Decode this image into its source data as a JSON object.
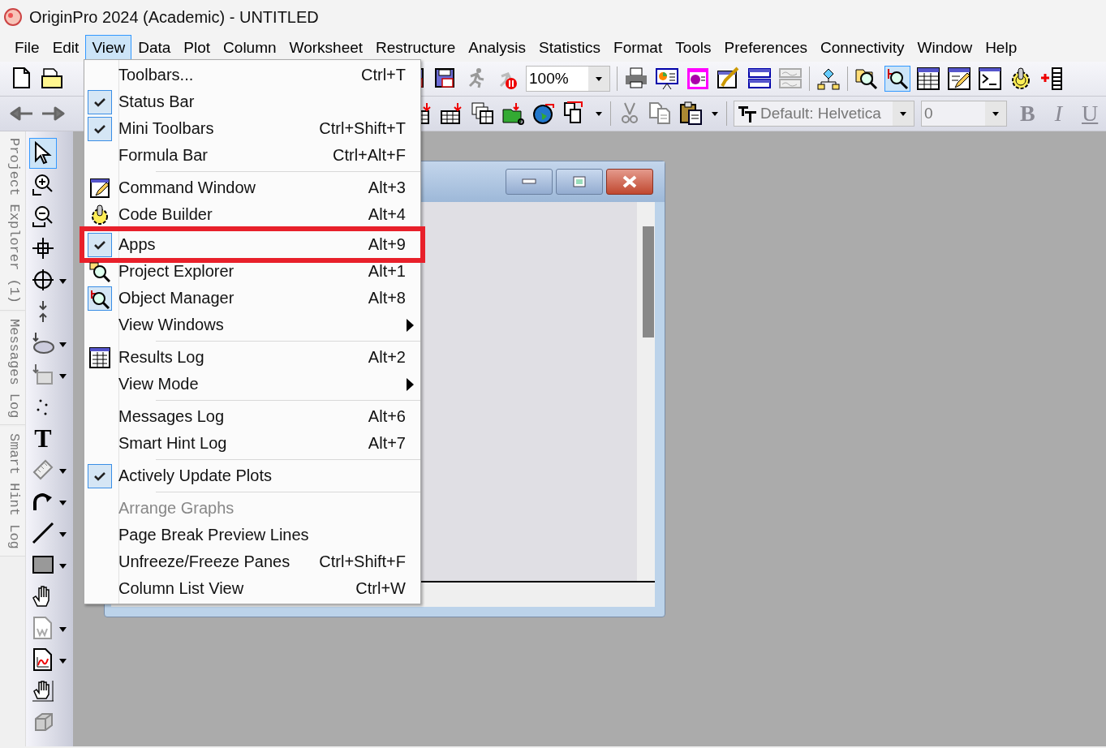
{
  "window": {
    "title": "OriginPro 2024 (Academic) - UNTITLED"
  },
  "menu_bar": [
    {
      "label": "File",
      "selected": false
    },
    {
      "label": "Edit",
      "selected": false
    },
    {
      "label": "View",
      "selected": true
    },
    {
      "label": "Data",
      "selected": false
    },
    {
      "label": "Plot",
      "selected": false
    },
    {
      "label": "Column",
      "selected": false
    },
    {
      "label": "Worksheet",
      "selected": false
    },
    {
      "label": "Restructure",
      "selected": false
    },
    {
      "label": "Analysis",
      "selected": false
    },
    {
      "label": "Statistics",
      "selected": false
    },
    {
      "label": "Format",
      "selected": false
    },
    {
      "label": "Tools",
      "selected": false
    },
    {
      "label": "Preferences",
      "selected": false
    },
    {
      "label": "Connectivity",
      "selected": false
    },
    {
      "label": "Window",
      "selected": false
    },
    {
      "label": "Help",
      "selected": false
    }
  ],
  "toolbar": {
    "zoom": "100%",
    "font": "Default: Helvetica",
    "font_size": "0",
    "style_buttons": [
      "B",
      "I",
      "U"
    ]
  },
  "dock_tabs": [
    "Project Explorer (1)",
    "Messages Log",
    "Smart Hint Log"
  ],
  "left_tools": [
    {
      "kind": "pointer",
      "selected": true,
      "dropdown": false
    },
    {
      "kind": "zoom-in",
      "selected": false,
      "dropdown": false
    },
    {
      "kind": "zoom-out",
      "selected": false,
      "dropdown": false
    },
    {
      "kind": "crosshair",
      "selected": false,
      "dropdown": false
    },
    {
      "kind": "reader",
      "selected": false,
      "dropdown": true
    },
    {
      "kind": "squeeze",
      "selected": false,
      "dropdown": false
    },
    {
      "kind": "ellipse",
      "selected": false,
      "dropdown": true
    },
    {
      "kind": "mask",
      "selected": false,
      "dropdown": true
    },
    {
      "kind": "dots",
      "selected": false,
      "dropdown": false
    },
    {
      "kind": "text",
      "label": "T",
      "selected": false,
      "dropdown": false
    },
    {
      "kind": "ruler",
      "selected": false,
      "dropdown": true
    },
    {
      "kind": "curve",
      "selected": false,
      "dropdown": true
    },
    {
      "kind": "line",
      "selected": false,
      "dropdown": true
    },
    {
      "kind": "rect",
      "selected": false,
      "dropdown": true
    },
    {
      "kind": "hand",
      "selected": false,
      "dropdown": false
    },
    {
      "kind": "doc",
      "selected": false,
      "dropdown": true
    },
    {
      "kind": "graph",
      "selected": false,
      "dropdown": true
    },
    {
      "kind": "hand-scale",
      "selected": false,
      "dropdown": false
    },
    {
      "kind": "box",
      "selected": false,
      "dropdown": false
    }
  ],
  "view_menu": {
    "items": [
      {
        "kind": "item",
        "label": "Toolbars...",
        "shortcut": "Ctrl+T",
        "checked": false,
        "disabled": false,
        "submenu": false,
        "highlighted": false
      },
      {
        "kind": "item",
        "label": "Status Bar",
        "checked": true,
        "disabled": false,
        "submenu": false,
        "highlighted": false
      },
      {
        "kind": "item",
        "label": "Mini Toolbars",
        "shortcut": "Ctrl+Shift+T",
        "checked": true,
        "disabled": false,
        "submenu": false,
        "highlighted": false
      },
      {
        "kind": "item",
        "label": "Formula Bar",
        "shortcut": "Ctrl+Alt+F",
        "checked": false,
        "disabled": false,
        "submenu": false,
        "highlighted": false
      },
      {
        "kind": "separator"
      },
      {
        "kind": "item",
        "label": "Command Window",
        "shortcut": "Alt+3",
        "checked": false,
        "disabled": false,
        "submenu": false,
        "highlighted": false
      },
      {
        "kind": "item",
        "label": "Code Builder",
        "shortcut": "Alt+4",
        "checked": false,
        "disabled": false,
        "submenu": false,
        "highlighted": false
      },
      {
        "kind": "item",
        "label": "Apps",
        "shortcut": "Alt+9",
        "checked": true,
        "disabled": false,
        "submenu": false,
        "highlighted": true
      },
      {
        "kind": "item",
        "label": "Project Explorer",
        "shortcut": "Alt+1",
        "checked": false,
        "disabled": false,
        "submenu": false,
        "highlighted": false
      },
      {
        "kind": "item",
        "label": "Object Manager",
        "shortcut": "Alt+8",
        "checked": true,
        "disabled": false,
        "submenu": false,
        "highlighted": false
      },
      {
        "kind": "item",
        "label": "View Windows",
        "checked": false,
        "disabled": false,
        "submenu": true,
        "highlighted": false
      },
      {
        "kind": "separator"
      },
      {
        "kind": "item",
        "label": "Results Log",
        "shortcut": "Alt+2",
        "checked": false,
        "disabled": false,
        "submenu": false,
        "highlighted": false
      },
      {
        "kind": "item",
        "label": "View Mode",
        "checked": false,
        "disabled": false,
        "submenu": true,
        "highlighted": false
      },
      {
        "kind": "separator"
      },
      {
        "kind": "item",
        "label": "Messages Log",
        "shortcut": "Alt+6",
        "checked": false,
        "disabled": false,
        "submenu": false,
        "highlighted": false
      },
      {
        "kind": "item",
        "label": "Smart Hint Log",
        "shortcut": "Alt+7",
        "checked": false,
        "disabled": false,
        "submenu": false,
        "highlighted": false
      },
      {
        "kind": "separator"
      },
      {
        "kind": "item",
        "label": "Actively Update Plots",
        "checked": true,
        "disabled": false,
        "submenu": false,
        "highlighted": false
      },
      {
        "kind": "separator"
      },
      {
        "kind": "item",
        "label": "Arrange Graphs",
        "checked": false,
        "disabled": true,
        "submenu": false,
        "highlighted": false
      },
      {
        "kind": "item",
        "label": "Page Break Preview Lines",
        "checked": false,
        "disabled": false,
        "submenu": false,
        "highlighted": false
      },
      {
        "kind": "item",
        "label": "Unfreeze/Freeze Panes",
        "shortcut": "Ctrl+Shift+F",
        "checked": false,
        "disabled": false,
        "submenu": false,
        "highlighted": false
      },
      {
        "kind": "item",
        "label": "Column List View",
        "shortcut": "Ctrl+W",
        "checked": false,
        "disabled": false,
        "submenu": false,
        "highlighted": false
      }
    ]
  }
}
